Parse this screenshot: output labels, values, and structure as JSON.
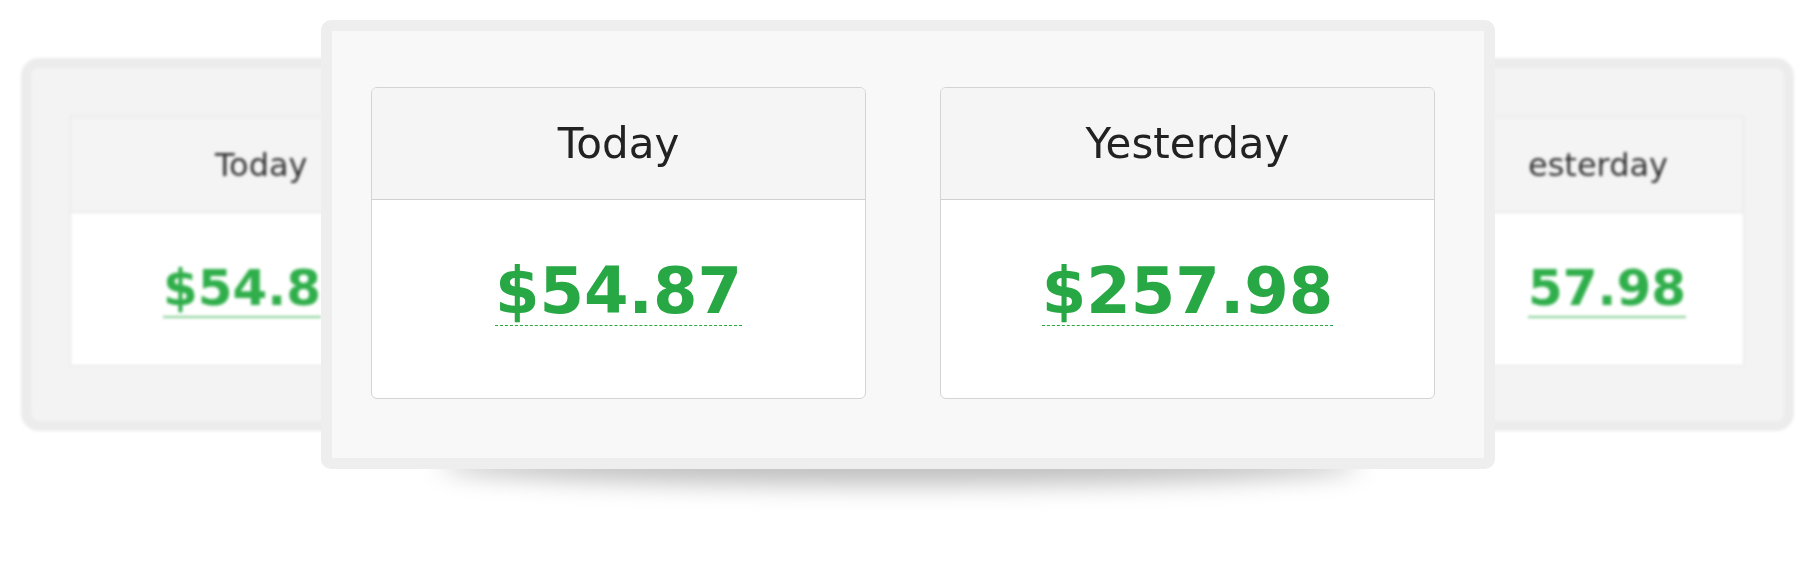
{
  "background_cards": [
    {
      "label": "Today",
      "amount": "$54.8"
    },
    {
      "label": "esterday",
      "amount": "57.98"
    }
  ],
  "cards": [
    {
      "label": "Today",
      "amount": "$54.87"
    },
    {
      "label": "Yesterday",
      "amount": "$257.98"
    }
  ]
}
